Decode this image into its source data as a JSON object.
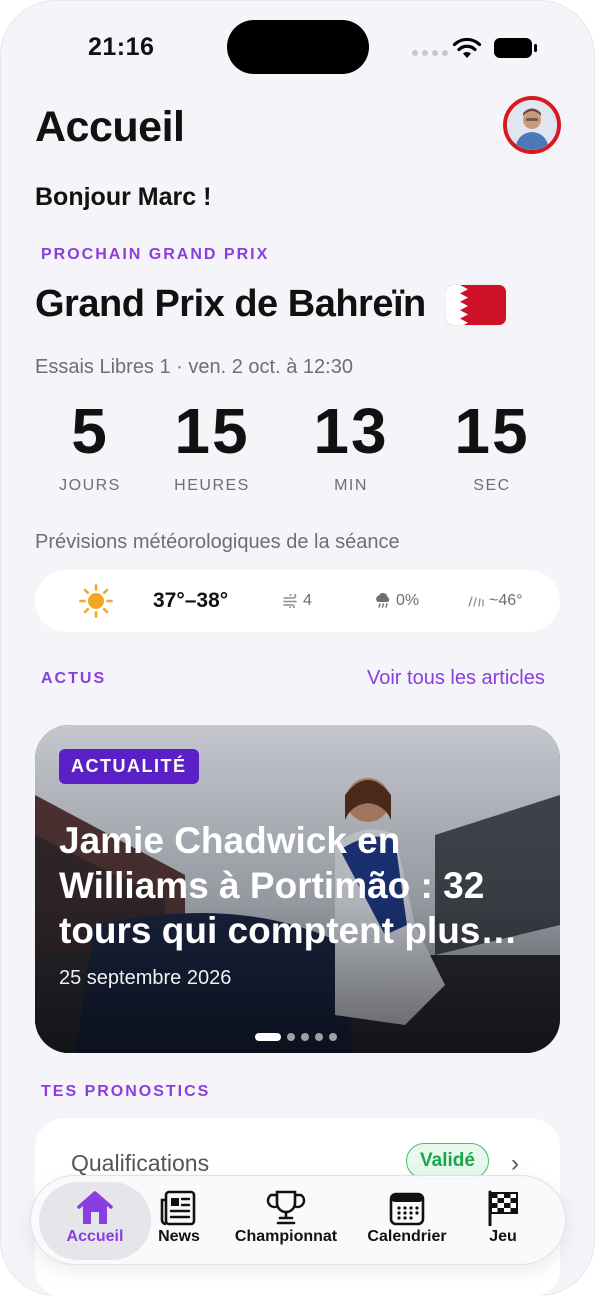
{
  "status_bar": {
    "time": "21:16"
  },
  "header": {
    "title": "Accueil",
    "greeting": "Bonjour Marc !"
  },
  "next_gp": {
    "eyebrow": "PROCHAIN GRAND PRIX",
    "name": "Grand Prix de Bahreïn",
    "flag": "bahrain-flag",
    "session": "Essais Libres 1 · ven. 2 oct. à 12:30",
    "countdown": [
      {
        "value": "5",
        "label": "JOURS"
      },
      {
        "value": "15",
        "label": "HEURES"
      },
      {
        "value": "13",
        "label": "MIN"
      },
      {
        "value": "15",
        "label": "SEC"
      }
    ],
    "forecast_label": "Prévisions météorologiques de la séance",
    "weather": {
      "icon": "sun-icon",
      "temp": "37°–38°",
      "wind": "4",
      "rain": "0%",
      "humidity": "~46°"
    }
  },
  "news": {
    "section_label": "ACTUS",
    "see_all": "Voir tous les articles",
    "card": {
      "badge": "ACTUALITÉ",
      "title": "Jamie Chadwick en Williams à Portimão : 32 tours qui comptent plus…",
      "date": "25 septembre 2026"
    }
  },
  "predictions": {
    "section_label": "TES PRONOSTICS",
    "items": [
      {
        "label": "Qualifications",
        "status": "Validé"
      }
    ]
  },
  "tabbar": {
    "items": [
      {
        "label": "Accueil",
        "icon": "home-icon"
      },
      {
        "label": "News",
        "icon": "newspaper-icon"
      },
      {
        "label": "Championnat",
        "icon": "trophy-icon"
      },
      {
        "label": "Calendrier",
        "icon": "calendar-icon"
      },
      {
        "label": "Jeu",
        "icon": "checkered-flag-icon"
      }
    ]
  },
  "colors": {
    "accent": "#8a3ee0",
    "badge": "#5b1fc7",
    "valid": "#18a84a",
    "avatar_ring": "#d71920"
  }
}
